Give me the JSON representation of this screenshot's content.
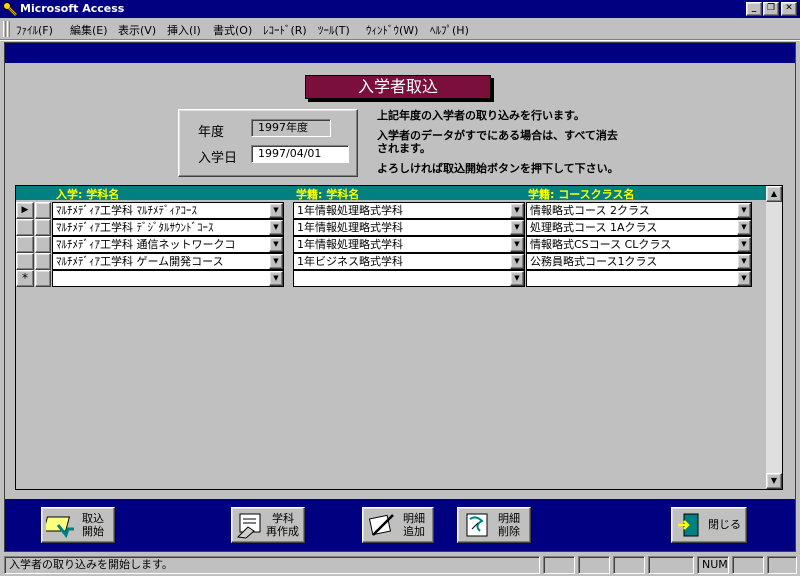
{
  "window": {
    "title": "Microsoft Access"
  },
  "menu": [
    {
      "label": "ﾌｧｲﾙ(F)"
    },
    {
      "label": "編集(E)"
    },
    {
      "label": "表示(V)"
    },
    {
      "label": "挿入(I)"
    },
    {
      "label": "書式(O)"
    },
    {
      "label": "ﾚｺｰﾄﾞ(R)"
    },
    {
      "label": "ﾂｰﾙ(T)"
    },
    {
      "label": "ｳｨﾝﾄﾞｳ(W)"
    },
    {
      "label": "ﾍﾙﾌﾟ(H)"
    }
  ],
  "form": {
    "title": "入学者取込",
    "year_label": "年度",
    "year_value": "1997年度",
    "date_label": "入学日",
    "date_value": "1997/04/01",
    "info_line1": "上記年度の入学者の取り込みを行います。",
    "info_line2a": "入学者のデータがすでにある場合は、すべて消去",
    "info_line2b": "されます。",
    "info_line3": "よろしければ取込開始ボタンを押下して下さい。"
  },
  "grid": {
    "columns": [
      "入学: 学科名",
      "学籍: 学科名",
      "学籍: コースクラス名"
    ],
    "rows": [
      {
        "c1": "ﾏﾙﾁﾒﾃﾞｨｱ工学科 ﾏﾙﾁﾒﾃﾞｨｱｺｰｽ",
        "c2": "1年情報処理略式学科",
        "c3": "情報略式コース 2クラス"
      },
      {
        "c1": "ﾏﾙﾁﾒﾃﾞｨｱ工学科 ﾃﾞｼﾞﾀﾙｻｳﾝﾄﾞｺｰｽ",
        "c2": "1年情報処理略式学科",
        "c3": "処理略式コース 1Aクラス"
      },
      {
        "c1": "ﾏﾙﾁﾒﾃﾞｨｱ工学科 通信ネットワークコ",
        "c2": "1年情報処理略式学科",
        "c3": "情報略式CSコース CLクラス"
      },
      {
        "c1": "ﾏﾙﾁﾒﾃﾞｨｱ工学科 ゲーム開発コース",
        "c2": "1年ビジネス略式学科",
        "c3": "公務員略式コース1クラス"
      }
    ],
    "new_row_marker": "*",
    "current_row_marker": "▶"
  },
  "buttons": {
    "start_l1": "取込",
    "start_l2": "開始",
    "recreate_l1": "学科",
    "recreate_l2": "再作成",
    "add_l1": "明細",
    "add_l2": "追加",
    "delete_l1": "明細",
    "delete_l2": "削除",
    "close": "閉じる"
  },
  "status": {
    "message": "入学者の取り込みを開始します。",
    "num": "NUM"
  },
  "colors": {
    "title_bar": "#000080",
    "form_title_bg": "#7a0f3c",
    "grid_header_bg": "#008080",
    "grid_header_text": "#ffff00"
  },
  "icons": [
    "key-icon",
    "minimize-icon",
    "restore-icon",
    "close-icon",
    "dropdown-arrow-icon",
    "record-selector-icon",
    "new-record-icon",
    "scroll-up-icon",
    "scroll-down-icon",
    "import-start-icon",
    "recreate-icon",
    "add-detail-icon",
    "delete-detail-icon",
    "exit-door-icon"
  ]
}
